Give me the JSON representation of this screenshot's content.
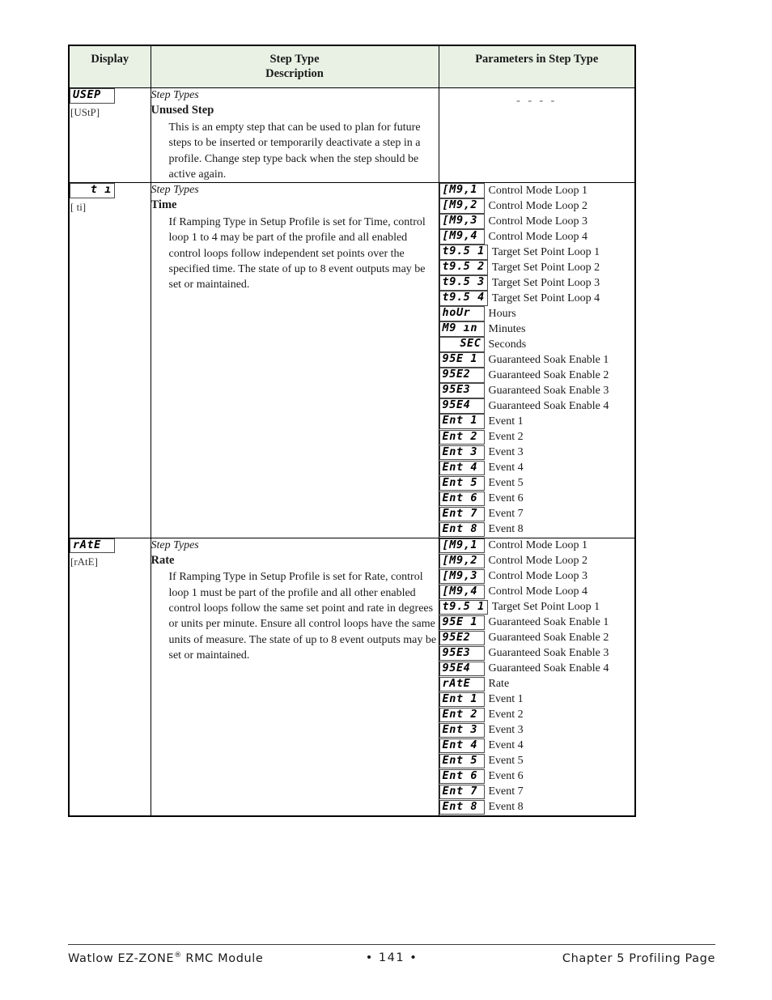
{
  "table": {
    "headers": {
      "display": "Display",
      "description_line1": "Step Type",
      "description_line2": "Description",
      "parameters": "Parameters in Step Type"
    },
    "rows": [
      {
        "display_code": "USEP",
        "display_alt": "[UStP]",
        "kicker": "Step Types",
        "title": "Unused Step",
        "body": "This is an empty step that can be used to plan for future steps to be inserted or temporarily deactivate a step in a profile. Change step type back when the step should be active again.",
        "params_empty": "- - - -",
        "params": []
      },
      {
        "display_code": "t ı",
        "display_alt": "[  ti]",
        "kicker": "Step Types",
        "title": "Time",
        "body": "If Ramping Type in Setup Profile is set for Time, control loop 1 to 4 may be part of the profile and all enabled control loops follow independent set points over the specified time. The state of up to 8 event outputs may be set or maintained.",
        "params_empty": "",
        "params": [
          {
            "code": "[M9,1",
            "label": "Control Mode Loop 1"
          },
          {
            "code": "[M9,2",
            "label": "Control Mode Loop 2"
          },
          {
            "code": "[M9,3",
            "label": "Control Mode Loop 3"
          },
          {
            "code": "[M9,4",
            "label": "Control Mode Loop 4"
          },
          {
            "code": "t9.5 1",
            "label": "Target Set Point Loop 1"
          },
          {
            "code": "t9.5 2",
            "label": "Target Set Point Loop 2"
          },
          {
            "code": "t9.5 3",
            "label": "Target Set Point Loop 3"
          },
          {
            "code": "t9.5 4",
            "label": "Target Set Point Loop 4"
          },
          {
            "code": "hoUr",
            "label": "Hours"
          },
          {
            "code": "M9 ın",
            "label": "Minutes"
          },
          {
            "code": "SEC",
            "label": "Seconds",
            "align": "right"
          },
          {
            "code": "95E 1",
            "label": "Guaranteed Soak Enable 1"
          },
          {
            "code": "95E2",
            "label": "Guaranteed Soak Enable 2"
          },
          {
            "code": "95E3",
            "label": "Guaranteed Soak Enable 3"
          },
          {
            "code": "95E4",
            "label": "Guaranteed Soak Enable 4"
          },
          {
            "code": "Ent 1",
            "label": "Event 1"
          },
          {
            "code": "Ent 2",
            "label": "Event 2"
          },
          {
            "code": "Ent 3",
            "label": "Event 3"
          },
          {
            "code": "Ent 4",
            "label": "Event 4"
          },
          {
            "code": "Ent 5",
            "label": "Event 5"
          },
          {
            "code": "Ent 6",
            "label": "Event 6"
          },
          {
            "code": "Ent 7",
            "label": "Event 7"
          },
          {
            "code": "Ent 8",
            "label": "Event 8"
          }
        ]
      },
      {
        "display_code": "rAtE",
        "display_alt": "[rAtE]",
        "kicker": "Step Types",
        "title": "Rate",
        "body": "If Ramping Type in Setup Profile is set for Rate, control loop 1 must be part of the profile and all other enabled control loops follow the same set point and rate in degrees or units per minute.  Ensure all control loops have the same units of measure. The state of up to 8 event outputs may be set or maintained.",
        "params_empty": "",
        "params": [
          {
            "code": "[M9,1",
            "label": "Control Mode Loop 1"
          },
          {
            "code": "[M9,2",
            "label": "Control Mode Loop 2"
          },
          {
            "code": "[M9,3",
            "label": "Control Mode Loop 3"
          },
          {
            "code": "[M9,4",
            "label": "Control Mode Loop 4"
          },
          {
            "code": "t9.5 1",
            "label": "Target Set Point Loop 1"
          },
          {
            "code": "95E 1",
            "label": "Guaranteed Soak Enable 1"
          },
          {
            "code": "95E2",
            "label": "Guaranteed Soak Enable 2"
          },
          {
            "code": "95E3",
            "label": "Guaranteed Soak Enable 3"
          },
          {
            "code": "95E4",
            "label": "Guaranteed Soak Enable 4"
          },
          {
            "code": "rAtE",
            "label": "Rate"
          },
          {
            "code": "Ent 1",
            "label": "Event 1"
          },
          {
            "code": "Ent 2",
            "label": "Event 2"
          },
          {
            "code": "Ent 3",
            "label": "Event 3"
          },
          {
            "code": "Ent 4",
            "label": "Event 4"
          },
          {
            "code": "Ent 5",
            "label": "Event 5"
          },
          {
            "code": "Ent 6",
            "label": "Event 6"
          },
          {
            "code": "Ent 7",
            "label": "Event 7"
          },
          {
            "code": "Ent 8",
            "label": "Event 8"
          }
        ]
      }
    ]
  },
  "footer": {
    "left_prefix": "Watlow EZ-ZONE",
    "left_sup": "®",
    "left_suffix": " RMC Module",
    "center": "•  141  •",
    "right": "Chapter 5 Profiling Page"
  },
  "colors": {
    "header_background": "#e8f1e4",
    "border": "#000000",
    "text": "#1a1a1a"
  }
}
